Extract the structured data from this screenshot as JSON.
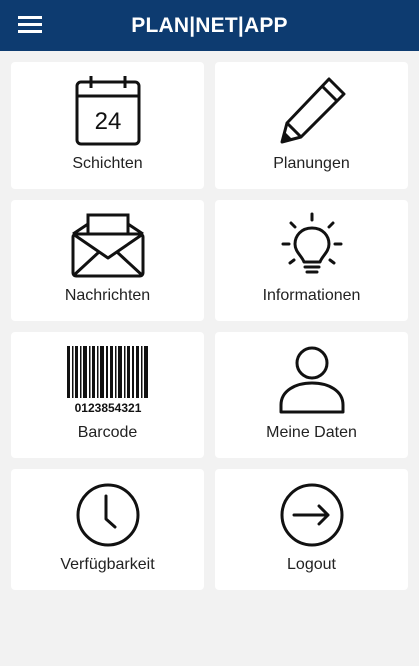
{
  "header": {
    "title": "PLAN|NET|APP",
    "background": "#0d3b70"
  },
  "tiles": [
    {
      "label": "Schichten",
      "icon": "calendar-icon",
      "day": "24"
    },
    {
      "label": "Planungen",
      "icon": "pencil-icon"
    },
    {
      "label": "Nachrichten",
      "icon": "envelope-icon"
    },
    {
      "label": "Informationen",
      "icon": "lightbulb-icon"
    },
    {
      "label": "Barcode",
      "icon": "barcode-icon",
      "code": "0123854321"
    },
    {
      "label": "Meine Daten",
      "icon": "user-icon"
    },
    {
      "label": "Verfügbarkeit",
      "icon": "clock-icon"
    },
    {
      "label": "Logout",
      "icon": "logout-arrow-icon"
    }
  ]
}
